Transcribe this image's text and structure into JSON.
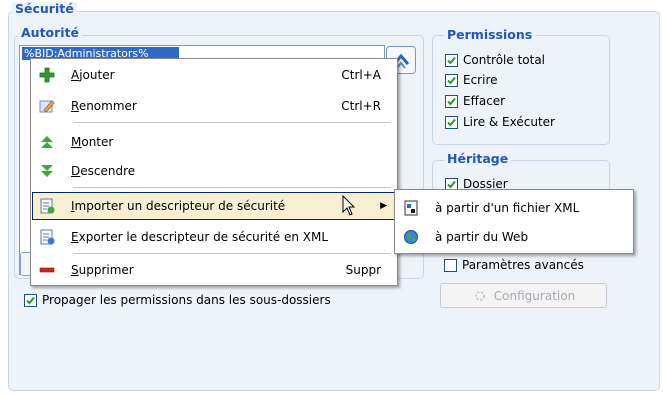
{
  "securite": {
    "title": "Sécurité"
  },
  "autorite": {
    "title": "Autorité",
    "selected_entry": "%BID:Administrators%"
  },
  "permissions": {
    "title": "Permissions",
    "items": [
      {
        "label": "Contrôle total",
        "checked": true
      },
      {
        "label": "Ecrire",
        "checked": true
      },
      {
        "label": "Effacer",
        "checked": true
      },
      {
        "label": "Lire & Exécuter",
        "checked": true
      }
    ]
  },
  "heritage": {
    "title": "Héritage",
    "dossier_label": "Dossier"
  },
  "parametres": {
    "label": "Paramètres avancés",
    "checked": false
  },
  "config_button": {
    "label": "Configuration"
  },
  "propager": {
    "label": "Propager les permissions dans les sous-dossiers",
    "checked": true
  },
  "context_menu": {
    "items": [
      {
        "label": "Ajouter",
        "underline": "A",
        "shortcut": "Ctrl+A",
        "icon": "plus-icon"
      },
      {
        "label": "Renommer",
        "underline": "R",
        "shortcut": "Ctrl+R",
        "icon": "rename-icon"
      },
      {
        "label": "Monter",
        "underline": "M",
        "shortcut": "",
        "icon": "arrow-up-icon"
      },
      {
        "label": "Descendre",
        "underline": "D",
        "shortcut": "",
        "icon": "arrow-down-icon"
      },
      {
        "label": "Importer un descripteur de sécurité",
        "underline": "I",
        "shortcut": "",
        "icon": "import-icon"
      },
      {
        "label": "Exporter le descripteur de sécurité en XML",
        "underline": "E",
        "shortcut": "",
        "icon": "export-icon"
      },
      {
        "label": "Supprimer",
        "underline": "S",
        "shortcut": "Suppr",
        "icon": "delete-icon"
      }
    ]
  },
  "submenu": {
    "items": [
      {
        "label": "à partir d'un fichier XML",
        "icon": "xml-file-icon"
      },
      {
        "label": "à partir du Web",
        "icon": "web-globe-icon"
      }
    ]
  },
  "colors": {
    "accent": "#2057b8",
    "selection": "#316ac5",
    "group_bg": "#eef3fa"
  }
}
